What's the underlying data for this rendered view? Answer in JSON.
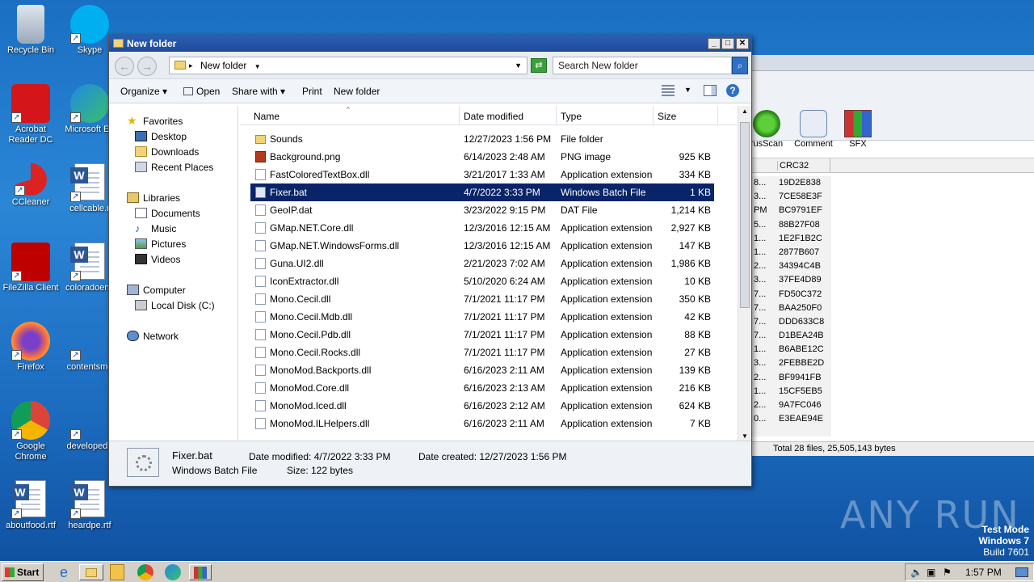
{
  "desktop": {
    "icons": [
      {
        "label": "Recycle Bin",
        "icon": "recycle-bin-icon"
      },
      {
        "label": "Skype",
        "icon": "skype-icon"
      },
      {
        "label": "Acrobat Reader DC",
        "icon": "acrobat-icon"
      },
      {
        "label": "Microsoft Ed",
        "icon": "edge-icon"
      },
      {
        "label": "CCleaner",
        "icon": "ccleaner-icon"
      },
      {
        "label": "cellcable.r",
        "icon": "word-doc-icon"
      },
      {
        "label": "FileZilla Client",
        "icon": "filezilla-icon"
      },
      {
        "label": "coloradoenc",
        "icon": "word-doc-icon"
      },
      {
        "label": "Firefox",
        "icon": "firefox-icon"
      },
      {
        "label": "contentsme",
        "icon": "blank-icon"
      },
      {
        "label": "Google Chrome",
        "icon": "chrome-icon"
      },
      {
        "label": "developedb",
        "icon": "blank-icon"
      },
      {
        "label": "aboutfood.rtf",
        "icon": "word-doc-icon"
      },
      {
        "label": "heardpe.rtf",
        "icon": "word-doc-icon"
      }
    ]
  },
  "background_window": {
    "toolbar": [
      {
        "label": "rusScan",
        "icon": "virus-scan-icon"
      },
      {
        "label": "Comment",
        "icon": "comment-icon"
      },
      {
        "label": "SFX",
        "icon": "sfx-icon"
      }
    ],
    "column_crc": "CRC32",
    "rows": [
      {
        "a": "8...",
        "crc": "19D2E838"
      },
      {
        "a": "3...",
        "crc": "7CE58E3F"
      },
      {
        "a": "PM",
        "crc": "BC9791EF"
      },
      {
        "a": "5...",
        "crc": "88B27F08"
      },
      {
        "a": "1...",
        "crc": "1E2F1B2C"
      },
      {
        "a": "1...",
        "crc": "2877B607"
      },
      {
        "a": "2...",
        "crc": "34394C4B"
      },
      {
        "a": "3...",
        "crc": "37FE4D89"
      },
      {
        "a": "7...",
        "crc": "FD50C372"
      },
      {
        "a": "7...",
        "crc": "BAA250F0"
      },
      {
        "a": "7...",
        "crc": "DDD633C8"
      },
      {
        "a": "7...",
        "crc": "D1BEA24B"
      },
      {
        "a": "1...",
        "crc": "B6ABE12C"
      },
      {
        "a": "3...",
        "crc": "2FEBBE2D"
      },
      {
        "a": "2...",
        "crc": "BF9941FB"
      },
      {
        "a": "1...",
        "crc": "15CF5EB5"
      },
      {
        "a": "2...",
        "crc": "9A7FC046"
      },
      {
        "a": "0...",
        "crc": "E3EAE94E"
      }
    ],
    "status": "Total 28 files, 25,505,143 bytes"
  },
  "explorer": {
    "title": "New folder",
    "address": "New folder",
    "search_placeholder": "Search New folder",
    "commands": {
      "organize": "Organize",
      "open": "Open",
      "share": "Share with",
      "print": "Print",
      "new_folder": "New folder"
    },
    "nav": {
      "favorites": "Favorites",
      "desktop": "Desktop",
      "downloads": "Downloads",
      "recent": "Recent Places",
      "libraries": "Libraries",
      "documents": "Documents",
      "music": "Music",
      "pictures": "Pictures",
      "videos": "Videos",
      "computer": "Computer",
      "local_disk": "Local Disk (C:)",
      "network": "Network"
    },
    "columns": {
      "name": "Name",
      "date": "Date modified",
      "type": "Type",
      "size": "Size"
    },
    "files": [
      {
        "name": "Sounds",
        "date": "12/27/2023 1:56 PM",
        "type": "File folder",
        "size": "",
        "kind": "folder"
      },
      {
        "name": "Background.png",
        "date": "6/14/2023 2:48 AM",
        "type": "PNG image",
        "size": "925 KB",
        "kind": "png"
      },
      {
        "name": "FastColoredTextBox.dll",
        "date": "3/21/2017 1:33 AM",
        "type": "Application extension",
        "size": "334 KB",
        "kind": "dll"
      },
      {
        "name": "Fixer.bat",
        "date": "4/7/2022 3:33 PM",
        "type": "Windows Batch File",
        "size": "1 KB",
        "kind": "bat",
        "selected": true
      },
      {
        "name": "GeoIP.dat",
        "date": "3/23/2022 9:15 PM",
        "type": "DAT File",
        "size": "1,214 KB",
        "kind": "dat"
      },
      {
        "name": "GMap.NET.Core.dll",
        "date": "12/3/2016 12:15 AM",
        "type": "Application extension",
        "size": "2,927 KB",
        "kind": "dll"
      },
      {
        "name": "GMap.NET.WindowsForms.dll",
        "date": "12/3/2016 12:15 AM",
        "type": "Application extension",
        "size": "147 KB",
        "kind": "dll"
      },
      {
        "name": "Guna.UI2.dll",
        "date": "2/21/2023 7:02 AM",
        "type": "Application extension",
        "size": "1,986 KB",
        "kind": "dll"
      },
      {
        "name": "IconExtractor.dll",
        "date": "5/10/2020 6:24 AM",
        "type": "Application extension",
        "size": "10 KB",
        "kind": "dll"
      },
      {
        "name": "Mono.Cecil.dll",
        "date": "7/1/2021 11:17 PM",
        "type": "Application extension",
        "size": "350 KB",
        "kind": "dll"
      },
      {
        "name": "Mono.Cecil.Mdb.dll",
        "date": "7/1/2021 11:17 PM",
        "type": "Application extension",
        "size": "42 KB",
        "kind": "dll"
      },
      {
        "name": "Mono.Cecil.Pdb.dll",
        "date": "7/1/2021 11:17 PM",
        "type": "Application extension",
        "size": "88 KB",
        "kind": "dll"
      },
      {
        "name": "Mono.Cecil.Rocks.dll",
        "date": "7/1/2021 11:17 PM",
        "type": "Application extension",
        "size": "27 KB",
        "kind": "dll"
      },
      {
        "name": "MonoMod.Backports.dll",
        "date": "6/16/2023 2:11 AM",
        "type": "Application extension",
        "size": "139 KB",
        "kind": "dll"
      },
      {
        "name": "MonoMod.Core.dll",
        "date": "6/16/2023 2:13 AM",
        "type": "Application extension",
        "size": "216 KB",
        "kind": "dll"
      },
      {
        "name": "MonoMod.Iced.dll",
        "date": "6/16/2023 2:12 AM",
        "type": "Application extension",
        "size": "624 KB",
        "kind": "dll"
      },
      {
        "name": "MonoMod.ILHelpers.dll",
        "date": "6/16/2023 2:11 AM",
        "type": "Application extension",
        "size": "7 KB",
        "kind": "dll"
      }
    ],
    "details": {
      "name": "Fixer.bat",
      "type": "Windows Batch File",
      "modified": "Date modified: 4/7/2022 3:33 PM",
      "size": "Size: 122 bytes",
      "created": "Date created: 12/27/2023 1:56 PM"
    }
  },
  "taskbar": {
    "start": "Start",
    "clock": "1:57 PM"
  },
  "watermark": {
    "line1": "Test Mode",
    "line2": "Windows 7",
    "line3": "Build 7601",
    "brand": "ANY RUN"
  }
}
